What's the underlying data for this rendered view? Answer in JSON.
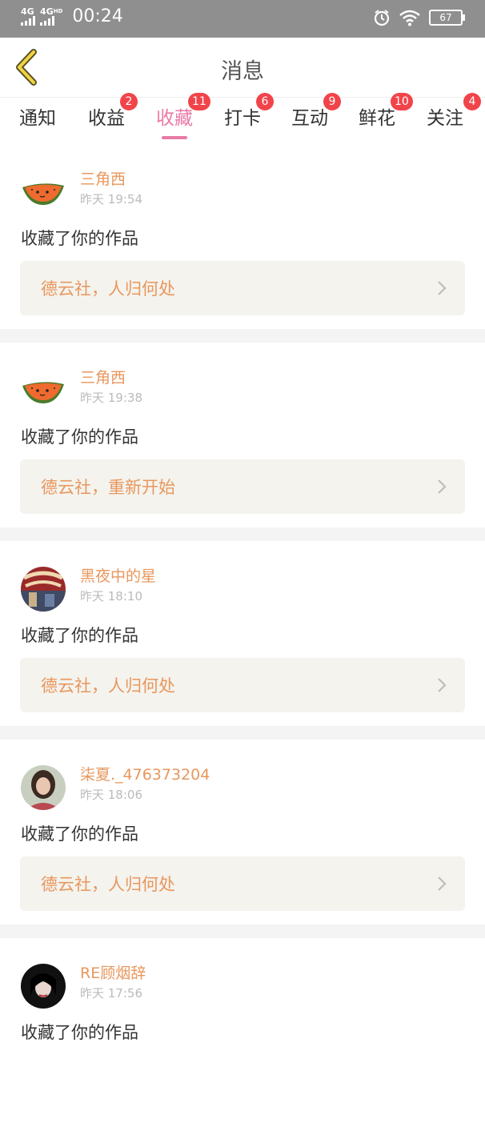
{
  "status": {
    "net1": "4G",
    "net2": "4G",
    "net2_sup": "HD",
    "time": "00:24",
    "battery": "67"
  },
  "header": {
    "title": "消息"
  },
  "tabs": [
    {
      "label": "通知",
      "badge": ""
    },
    {
      "label": "收益",
      "badge": "2"
    },
    {
      "label": "收藏",
      "badge": "11"
    },
    {
      "label": "打卡",
      "badge": "6"
    },
    {
      "label": "互动",
      "badge": "9"
    },
    {
      "label": "鲜花",
      "badge": "10"
    },
    {
      "label": "关注",
      "badge": "4"
    }
  ],
  "active_tab": "收藏",
  "items": [
    {
      "user": "三角西",
      "time": "昨天 19:54",
      "action": "收藏了你的作品",
      "work": "德云社，人归何处",
      "avatar": "watermelon-avatar"
    },
    {
      "user": "三角西",
      "time": "昨天 19:38",
      "action": "收藏了你的作品",
      "work": "德云社，重新开始",
      "avatar": "watermelon-avatar"
    },
    {
      "user": "黑夜中的星",
      "time": "昨天 18:10",
      "action": "收藏了你的作品",
      "work": "德云社，人归何处",
      "avatar": "union-company-avatar"
    },
    {
      "user": "柒夏._476373204",
      "time": "昨天 18:06",
      "action": "收藏了你的作品",
      "work": "德云社，人归何处",
      "avatar": "girl-photo-avatar"
    },
    {
      "user": "RE顾烟辞",
      "time": "昨天 17:56",
      "action": "收藏了你的作品",
      "work": "",
      "avatar": "dark-photo-avatar"
    }
  ],
  "colors": {
    "accent": "#e97aa6",
    "name": "#e8975d",
    "badge": "#f1444a",
    "statusbar": "#8f8f8f"
  }
}
